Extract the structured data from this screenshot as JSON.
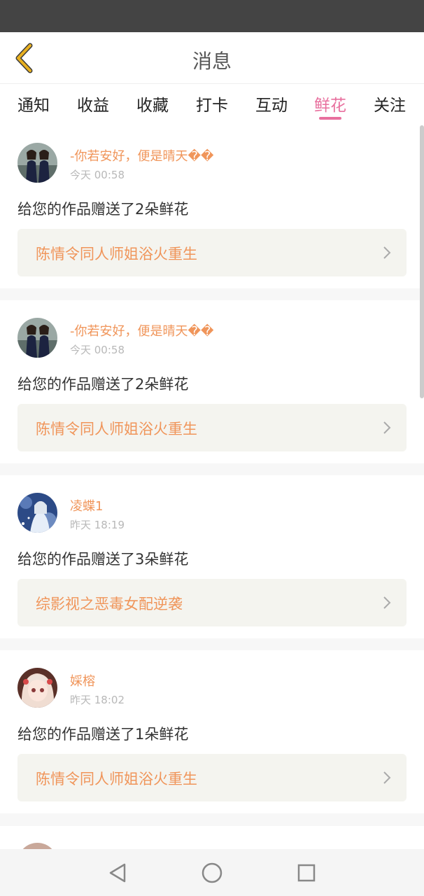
{
  "header": {
    "title": "消息"
  },
  "tabs": [
    {
      "label": "通知"
    },
    {
      "label": "收益"
    },
    {
      "label": "收藏"
    },
    {
      "label": "打卡"
    },
    {
      "label": "互动"
    },
    {
      "label": "鲜花",
      "active": true
    },
    {
      "label": "关注"
    }
  ],
  "messages": [
    {
      "username": "-你若安好，便是晴天��",
      "time": "今天 00:58",
      "text": "给您的作品赠送了2朵鲜花",
      "work": "陈情令同人师姐浴火重生"
    },
    {
      "username": "-你若安好，便是晴天��",
      "time": "今天 00:58",
      "text": "给您的作品赠送了2朵鲜花",
      "work": "陈情令同人师姐浴火重生"
    },
    {
      "username": "凌蝶1",
      "time": "昨天 18:19",
      "text": "给您的作品赠送了3朵鲜花",
      "work": "综影视之恶毒女配逆袭"
    },
    {
      "username": "婇榕",
      "time": "昨天 18:02",
      "text": "给您的作品赠送了1朵鲜花",
      "work": "陈情令同人师姐浴火重生"
    }
  ],
  "colors": {
    "accent_tab": "#e8709e",
    "username": "#f0955a",
    "back_arrow": "#e8b020",
    "status_bar": "#444444"
  },
  "icons": {
    "back": "chevron-left-icon",
    "link": "chevron-right-icon",
    "nav": [
      "nav-back-icon",
      "nav-home-icon",
      "nav-recents-icon"
    ]
  }
}
